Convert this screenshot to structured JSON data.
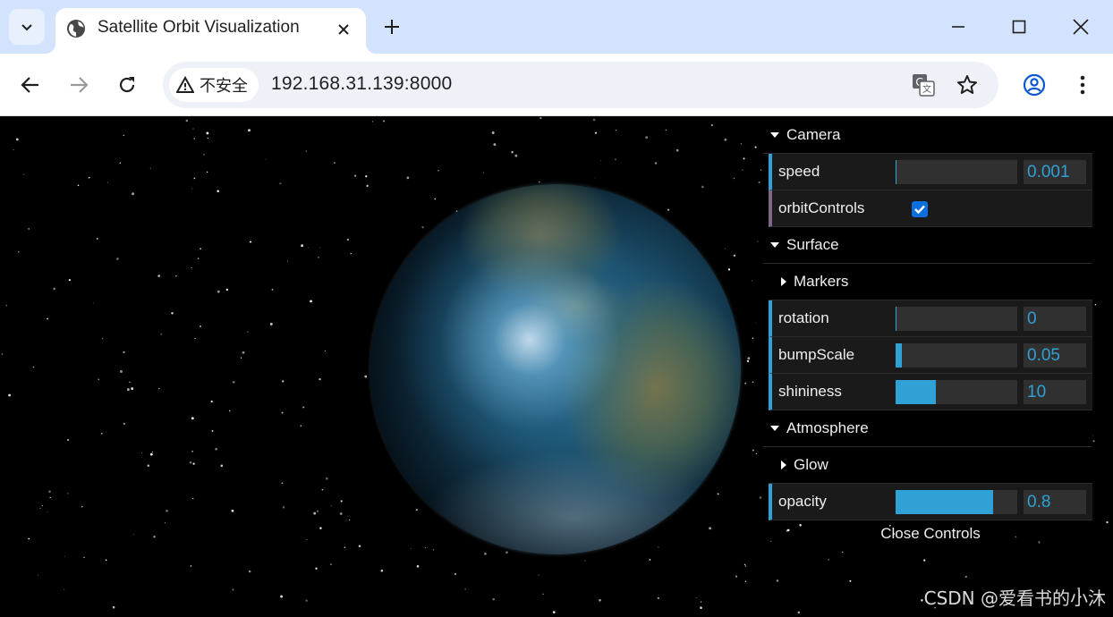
{
  "browser": {
    "tab_title": "Satellite Orbit Visualization",
    "security_label": "不安全",
    "url": "192.168.31.139:8000"
  },
  "gui": {
    "camera": {
      "title": "Camera",
      "speed": {
        "label": "speed",
        "value": "0.001",
        "fraction": 0.005
      },
      "orbitControls": {
        "label": "orbitControls",
        "checked": true
      }
    },
    "surface": {
      "title": "Surface",
      "markers": {
        "title": "Markers"
      },
      "rotation": {
        "label": "rotation",
        "value": "0",
        "fraction": 0.0
      },
      "bumpScale": {
        "label": "bumpScale",
        "value": "0.05",
        "fraction": 0.05
      },
      "shininess": {
        "label": "shininess",
        "value": "10",
        "fraction": 0.33
      }
    },
    "atmosphere": {
      "title": "Atmosphere",
      "glow": {
        "title": "Glow"
      },
      "opacity": {
        "label": "opacity",
        "value": "0.8",
        "fraction": 0.8
      }
    },
    "close_label": "Close Controls"
  },
  "watermark": "CSDN @爱看书的小沐",
  "colors": {
    "accent": "#2fa1d6",
    "boolean_accent": "#806787",
    "tab_strip": "#d3e3fd"
  }
}
